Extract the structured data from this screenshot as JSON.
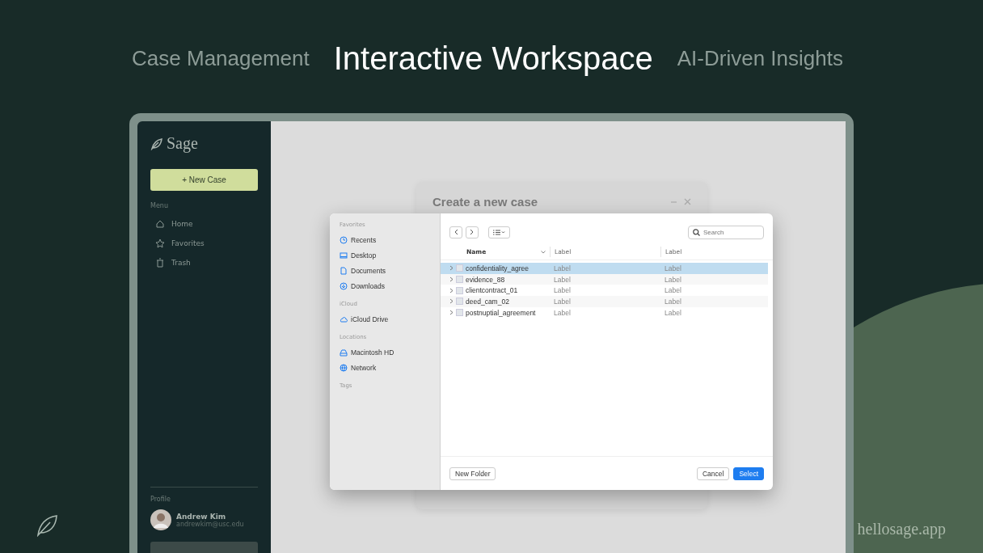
{
  "headline": {
    "tabs": [
      {
        "label": "Case Management",
        "selected": false
      },
      {
        "label": "Interactive Workspace",
        "selected": true
      },
      {
        "label": "AI-Driven Insights",
        "selected": false
      }
    ]
  },
  "app": {
    "logo": "Sage",
    "new_case_button": "+ New Case",
    "menu_heading": "Menu",
    "menu": [
      {
        "label": "Home"
      },
      {
        "label": "Favorites"
      },
      {
        "label": "Trash"
      }
    ],
    "profile_heading": "Profile",
    "user": {
      "name": "Andrew Kim",
      "email": "andrewkim@usc.edu"
    }
  },
  "background_dialog": {
    "title": "Create a new case"
  },
  "file_picker": {
    "sidebar": [
      {
        "heading": "Favorites",
        "items": [
          {
            "label": "Recents"
          },
          {
            "label": "Desktop"
          },
          {
            "label": "Documents"
          },
          {
            "label": "Downloads"
          }
        ]
      },
      {
        "heading": "iCloud",
        "items": [
          {
            "label": "iCloud Drive"
          }
        ]
      },
      {
        "heading": "Locations",
        "items": [
          {
            "label": "Macintosh HD"
          },
          {
            "label": "Network"
          }
        ]
      },
      {
        "heading": "Tags"
      }
    ],
    "search": {
      "placeholder": "Search"
    },
    "columns": [
      "Name",
      "Label",
      "Label"
    ],
    "rows": [
      {
        "name": "confidentiality_agree",
        "column_2": "Label",
        "column_3": "Label",
        "selected": true
      },
      {
        "name": "evidence_88",
        "column_2": "Label",
        "column_3": "Label",
        "selected": false
      },
      {
        "name": "clientcontract_01",
        "column_2": "Label",
        "column_3": "Label",
        "selected": false
      },
      {
        "name": "deed_cam_02",
        "column_2": "Label",
        "column_3": "Label",
        "selected": false
      },
      {
        "name": "postnuptial_agreement",
        "column_2": "Label",
        "column_3": "Label",
        "selected": false
      }
    ],
    "new_folder_button": "New Folder",
    "cancel_button": "Cancel",
    "select_button": "Select"
  },
  "footer": {
    "site": "hellosage.app"
  }
}
